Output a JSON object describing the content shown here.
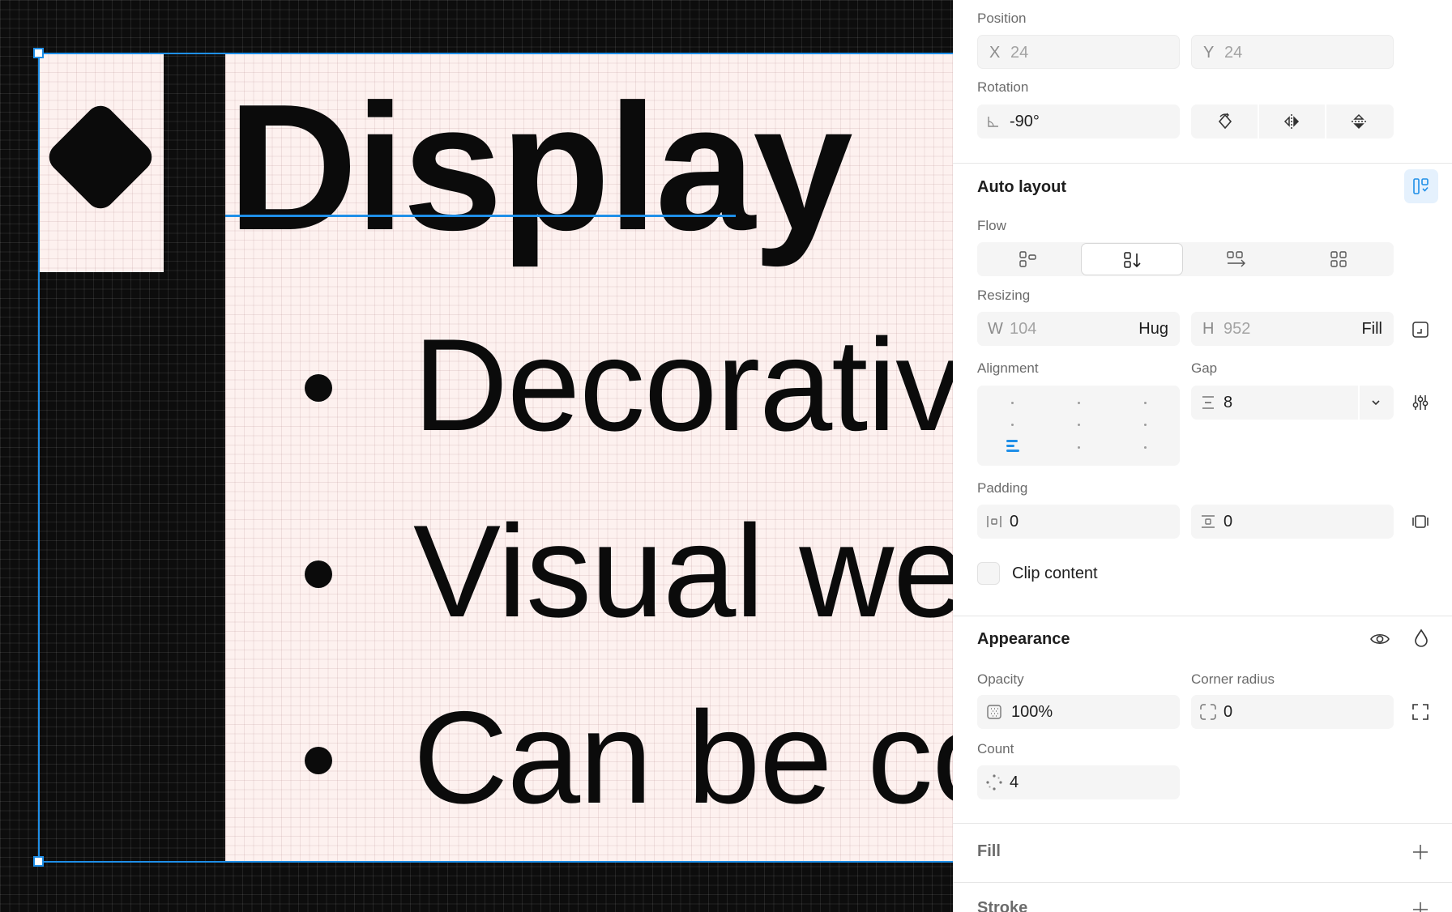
{
  "canvas": {
    "display_text": "Display",
    "list_items": [
      "Decorative",
      "Visual wei",
      "Can be co"
    ]
  },
  "panel": {
    "position": {
      "title": "Position",
      "x": {
        "label": "X",
        "value": "24"
      },
      "y": {
        "label": "Y",
        "value": "24"
      }
    },
    "rotation": {
      "title": "Rotation",
      "value": "-90°"
    },
    "auto_layout": {
      "title": "Auto layout",
      "flow": {
        "title": "Flow",
        "options": [
          "grid-flow-icon",
          "vertical-flow-icon",
          "horizontal-flow-icon",
          "wrap-flow-icon"
        ],
        "selected": "vertical-flow-icon"
      },
      "resizing": {
        "title": "Resizing",
        "width": {
          "label": "W",
          "value": "104",
          "mode": "Hug"
        },
        "height": {
          "label": "H",
          "value": "952",
          "mode": "Fill"
        }
      },
      "alignment": {
        "title": "Alignment",
        "selected": "bottom-left"
      },
      "gap": {
        "title": "Gap",
        "value": "8"
      },
      "padding": {
        "title": "Padding",
        "horizontal": "0",
        "vertical": "0"
      },
      "clip_content": {
        "label": "Clip content",
        "checked": false
      }
    },
    "appearance": {
      "title": "Appearance",
      "opacity": {
        "title": "Opacity",
        "value": "100%"
      },
      "corner_radius": {
        "title": "Corner radius",
        "value": "0"
      },
      "count": {
        "title": "Count",
        "value": "4"
      }
    },
    "fill": {
      "title": "Fill"
    },
    "stroke": {
      "title": "Stroke"
    },
    "colors": {
      "accent": "#1f8fe8",
      "selection": "#1f8fe8"
    }
  }
}
